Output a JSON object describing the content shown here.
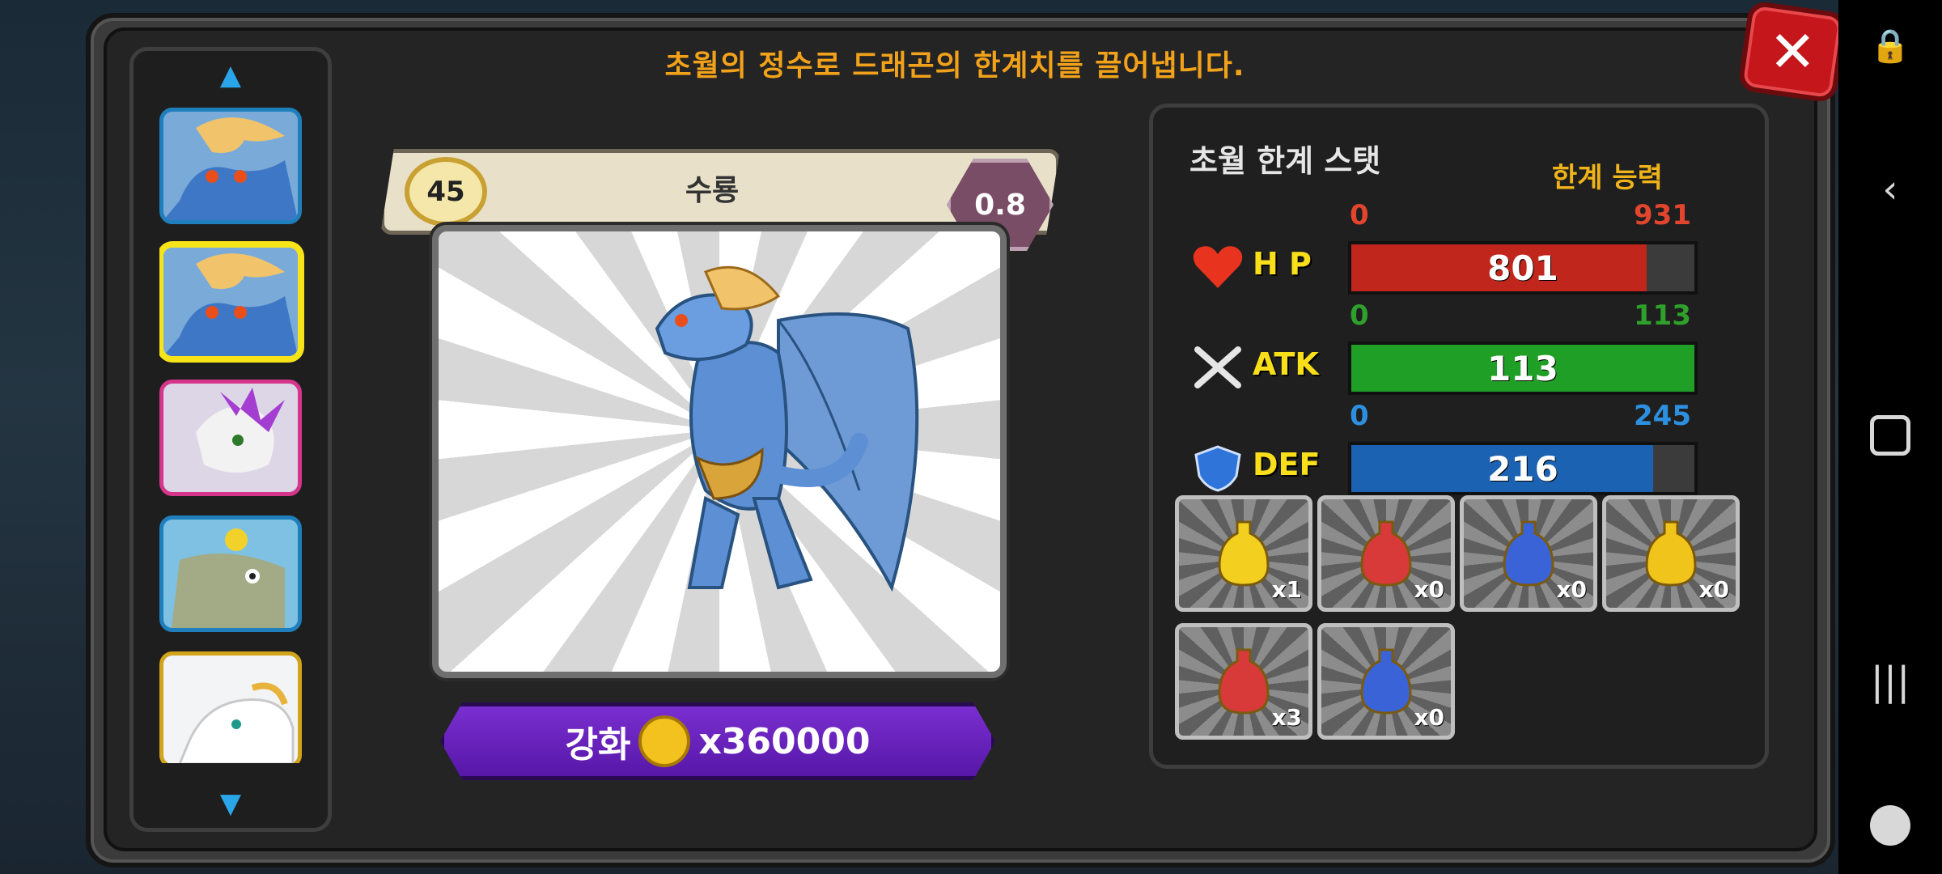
{
  "header": {
    "title": "초월의 정수로 드래곤의 한계치를 끌어냅니다."
  },
  "dragon": {
    "level": "45",
    "name": "수룡",
    "grade": "0.8"
  },
  "enhance": {
    "label": "강화",
    "cost": "x360000"
  },
  "stats": {
    "title": "초월 한계 스탯",
    "limit_label": "한계 능력",
    "rows": [
      {
        "name": "H P",
        "min": "0",
        "max": "931",
        "value": "801",
        "fill_fraction": 0.86,
        "color": "#c0261c",
        "min_color": "#e2452d",
        "max_color": "#e2452d"
      },
      {
        "name": "ATK",
        "min": "0",
        "max": "113",
        "value": "113",
        "fill_fraction": 1.0,
        "color": "#1f9f26",
        "min_color": "#2fa02b",
        "max_color": "#2fa02b"
      },
      {
        "name": "DEF",
        "min": "0",
        "max": "245",
        "value": "216",
        "fill_fraction": 0.88,
        "color": "#1b62b2",
        "min_color": "#2d8fe0",
        "max_color": "#2d8fe0"
      }
    ]
  },
  "items": [
    {
      "count": "x1",
      "color": "#f3d020"
    },
    {
      "count": "x0",
      "color": "#d83a3a"
    },
    {
      "count": "x0",
      "color": "#3a63d8"
    },
    {
      "count": "x0",
      "color": "#f0c41b"
    },
    {
      "count": "x3",
      "color": "#d83a3a"
    },
    {
      "count": "x0",
      "color": "#3a63d8"
    }
  ],
  "colors": {
    "accent_orange": "#f2a21a",
    "panel_dark": "#242424",
    "close_red": "#c4161b",
    "button_purple": "#6a22c0"
  }
}
